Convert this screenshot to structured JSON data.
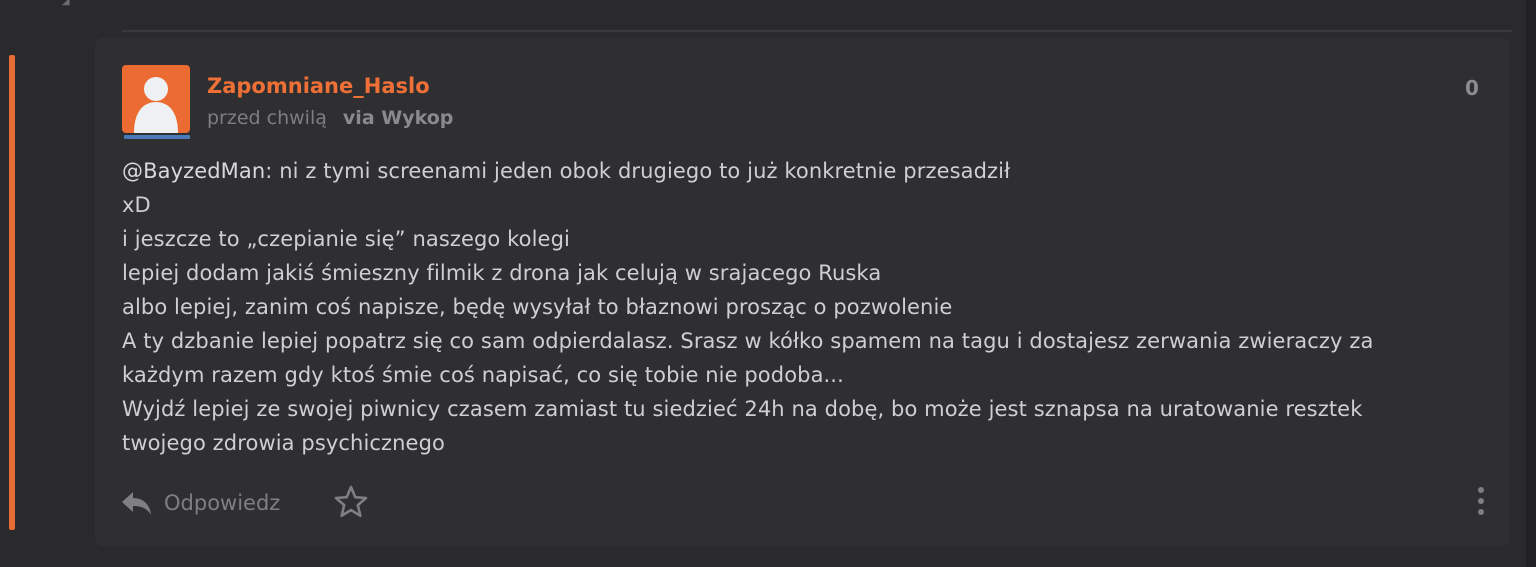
{
  "post": {
    "author": "Zapomniane_Haslo",
    "time": "przed chwilą",
    "via": "via Wykop",
    "votes": "0",
    "mention": "@BayzedMan",
    "first_line_rest": ": ni z tymi screenami jeden obok drugiego to już konkretnie przesadził",
    "lines": [
      "xD",
      "i jeszcze to „czepianie się” naszego kolegi",
      "lepiej dodam jakiś śmieszny filmik z drona jak celują w srajacego Ruska",
      "albo lepiej, zanim coś napisze, będę wysyłał to błaznowi prosząc o pozwolenie",
      "A ty dzbanie lepiej popatrz się co sam odpierdalasz. Srasz w kółko spamem na tagu i dostajesz zerwania zwieraczy za",
      "każdym razem gdy ktoś śmie coś napisać, co się tobie nie podoba...",
      "Wyjdź lepiej ze swojej piwnicy czasem zamiast tu siedzieć 24h na dobę, bo może jest sznapsa na uratowanie resztek",
      "twojego zdrowia psychicznego"
    ]
  },
  "actions": {
    "reply_label": "Odpowiedz",
    "reply_icon": "reply-arrow-icon",
    "favorite_icon": "star-icon",
    "more_icon": "vertical-dots-icon"
  },
  "colors": {
    "accent": "#ee7036",
    "avatar_underline": "#4b7bb6",
    "card_bg": "#2f2f31"
  }
}
